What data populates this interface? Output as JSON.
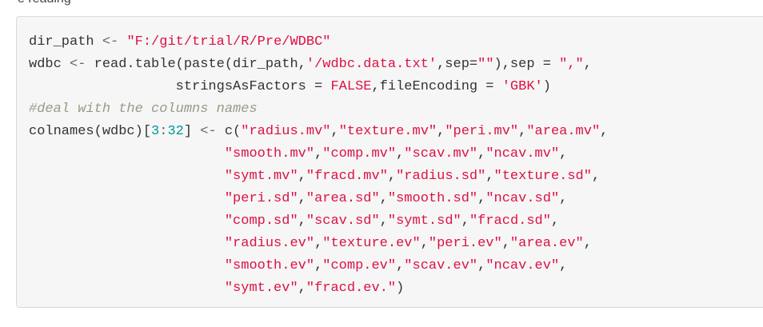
{
  "top_fragment": "e reading",
  "code": {
    "lines": [
      [
        {
          "t": "dir_path ",
          "k": "plain"
        },
        {
          "t": "<-",
          "k": "op"
        },
        {
          "t": " ",
          "k": "plain"
        },
        {
          "t": "\"F:/git/trial/R/Pre/WDBC\"",
          "k": "str"
        }
      ],
      [
        {
          "t": "wdbc ",
          "k": "plain"
        },
        {
          "t": "<-",
          "k": "op"
        },
        {
          "t": " read.table(paste(dir_path,",
          "k": "plain"
        },
        {
          "t": "'/wdbc.data.txt'",
          "k": "str"
        },
        {
          "t": ",sep=",
          "k": "plain"
        },
        {
          "t": "\"\"",
          "k": "str"
        },
        {
          "t": "),sep = ",
          "k": "plain"
        },
        {
          "t": "\",\"",
          "k": "str"
        },
        {
          "t": ",",
          "k": "plain"
        }
      ],
      [
        {
          "t": "                  stringsAsFactors = ",
          "k": "plain"
        },
        {
          "t": "FALSE",
          "k": "const"
        },
        {
          "t": ",fileEncoding = ",
          "k": "plain"
        },
        {
          "t": "'GBK'",
          "k": "str"
        },
        {
          "t": ")",
          "k": "plain"
        }
      ],
      [
        {
          "t": "#deal with the columns names",
          "k": "com"
        }
      ],
      [
        {
          "t": "colnames(wdbc)[",
          "k": "plain"
        },
        {
          "t": "3",
          "k": "num"
        },
        {
          "t": ":",
          "k": "op"
        },
        {
          "t": "32",
          "k": "num"
        },
        {
          "t": "] ",
          "k": "plain"
        },
        {
          "t": "<-",
          "k": "op"
        },
        {
          "t": " c(",
          "k": "plain"
        },
        {
          "t": "\"radius.mv\"",
          "k": "str"
        },
        {
          "t": ",",
          "k": "plain"
        },
        {
          "t": "\"texture.mv\"",
          "k": "str"
        },
        {
          "t": ",",
          "k": "plain"
        },
        {
          "t": "\"peri.mv\"",
          "k": "str"
        },
        {
          "t": ",",
          "k": "plain"
        },
        {
          "t": "\"area.mv\"",
          "k": "str"
        },
        {
          "t": ",",
          "k": "plain"
        }
      ],
      [
        {
          "t": "                        ",
          "k": "plain"
        },
        {
          "t": "\"smooth.mv\"",
          "k": "str"
        },
        {
          "t": ",",
          "k": "plain"
        },
        {
          "t": "\"comp.mv\"",
          "k": "str"
        },
        {
          "t": ",",
          "k": "plain"
        },
        {
          "t": "\"scav.mv\"",
          "k": "str"
        },
        {
          "t": ",",
          "k": "plain"
        },
        {
          "t": "\"ncav.mv\"",
          "k": "str"
        },
        {
          "t": ",",
          "k": "plain"
        }
      ],
      [
        {
          "t": "                        ",
          "k": "plain"
        },
        {
          "t": "\"symt.mv\"",
          "k": "str"
        },
        {
          "t": ",",
          "k": "plain"
        },
        {
          "t": "\"fracd.mv\"",
          "k": "str"
        },
        {
          "t": ",",
          "k": "plain"
        },
        {
          "t": "\"radius.sd\"",
          "k": "str"
        },
        {
          "t": ",",
          "k": "plain"
        },
        {
          "t": "\"texture.sd\"",
          "k": "str"
        },
        {
          "t": ",",
          "k": "plain"
        }
      ],
      [
        {
          "t": "                        ",
          "k": "plain"
        },
        {
          "t": "\"peri.sd\"",
          "k": "str"
        },
        {
          "t": ",",
          "k": "plain"
        },
        {
          "t": "\"area.sd\"",
          "k": "str"
        },
        {
          "t": ",",
          "k": "plain"
        },
        {
          "t": "\"smooth.sd\"",
          "k": "str"
        },
        {
          "t": ",",
          "k": "plain"
        },
        {
          "t": "\"ncav.sd\"",
          "k": "str"
        },
        {
          "t": ",",
          "k": "plain"
        }
      ],
      [
        {
          "t": "                        ",
          "k": "plain"
        },
        {
          "t": "\"comp.sd\"",
          "k": "str"
        },
        {
          "t": ",",
          "k": "plain"
        },
        {
          "t": "\"scav.sd\"",
          "k": "str"
        },
        {
          "t": ",",
          "k": "plain"
        },
        {
          "t": "\"symt.sd\"",
          "k": "str"
        },
        {
          "t": ",",
          "k": "plain"
        },
        {
          "t": "\"fracd.sd\"",
          "k": "str"
        },
        {
          "t": ",",
          "k": "plain"
        }
      ],
      [
        {
          "t": "                        ",
          "k": "plain"
        },
        {
          "t": "\"radius.ev\"",
          "k": "str"
        },
        {
          "t": ",",
          "k": "plain"
        },
        {
          "t": "\"texture.ev\"",
          "k": "str"
        },
        {
          "t": ",",
          "k": "plain"
        },
        {
          "t": "\"peri.ev\"",
          "k": "str"
        },
        {
          "t": ",",
          "k": "plain"
        },
        {
          "t": "\"area.ev\"",
          "k": "str"
        },
        {
          "t": ",",
          "k": "plain"
        }
      ],
      [
        {
          "t": "                        ",
          "k": "plain"
        },
        {
          "t": "\"smooth.ev\"",
          "k": "str"
        },
        {
          "t": ",",
          "k": "plain"
        },
        {
          "t": "\"comp.ev\"",
          "k": "str"
        },
        {
          "t": ",",
          "k": "plain"
        },
        {
          "t": "\"scav.ev\"",
          "k": "str"
        },
        {
          "t": ",",
          "k": "plain"
        },
        {
          "t": "\"ncav.ev\"",
          "k": "str"
        },
        {
          "t": ",",
          "k": "plain"
        }
      ],
      [
        {
          "t": "                        ",
          "k": "plain"
        },
        {
          "t": "\"symt.ev\"",
          "k": "str"
        },
        {
          "t": ",",
          "k": "plain"
        },
        {
          "t": "\"fracd.ev.\"",
          "k": "str"
        },
        {
          "t": ")",
          "k": "plain"
        }
      ]
    ]
  }
}
